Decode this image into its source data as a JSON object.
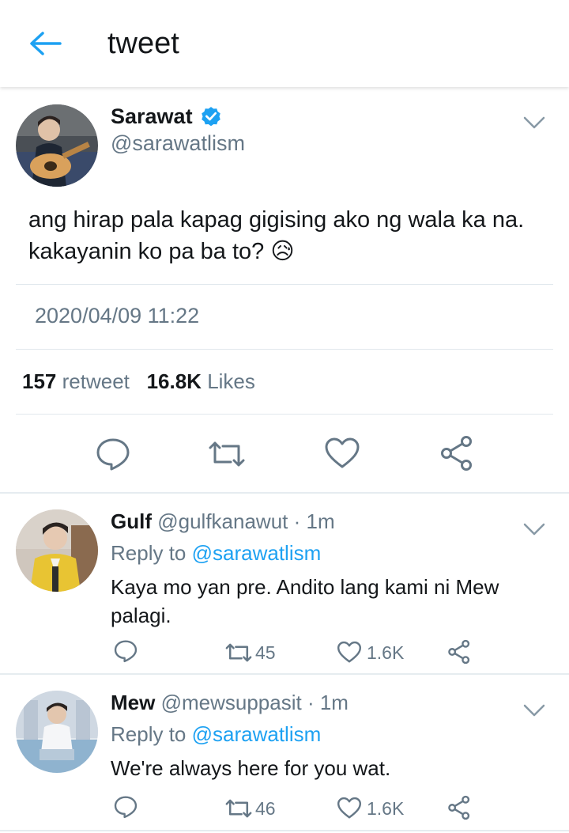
{
  "header": {
    "title": "tweet",
    "back_icon": "arrow-left-icon",
    "accent": "#1da1f2"
  },
  "tweet": {
    "name": "Sarawat",
    "handle": "@sarawatlism",
    "verified": true,
    "text": "ang hirap pala kapag gigising ako ng wala ka na. kakayanin ko pa ba to?",
    "emoji": "😥",
    "timestamp": "2020/04/09 11:22",
    "retweet_count": "157",
    "retweet_label": "retweet",
    "likes_count": "16.8K",
    "likes_label": "Likes"
  },
  "replies": [
    {
      "name": "Gulf",
      "handle": "@gulfkanawut",
      "time": " · 1m",
      "reply_prefix": "Reply to",
      "reply_to": "@sarawatlism",
      "text": "Kaya mo yan pre. Andito lang kami ni Mew palagi.",
      "retweets": "45",
      "likes": "1.6K"
    },
    {
      "name": "Mew",
      "handle": "@mewsuppasit",
      "time": " · 1m",
      "reply_prefix": "Reply to",
      "reply_to": "@sarawatlism",
      "text": "We're always here for you wat.",
      "retweets": "46",
      "likes": "1.6K"
    }
  ],
  "colors": {
    "text": "#14171a",
    "secondary": "#657786",
    "divider": "#e1e8ed",
    "verified": "#1da1f2"
  }
}
